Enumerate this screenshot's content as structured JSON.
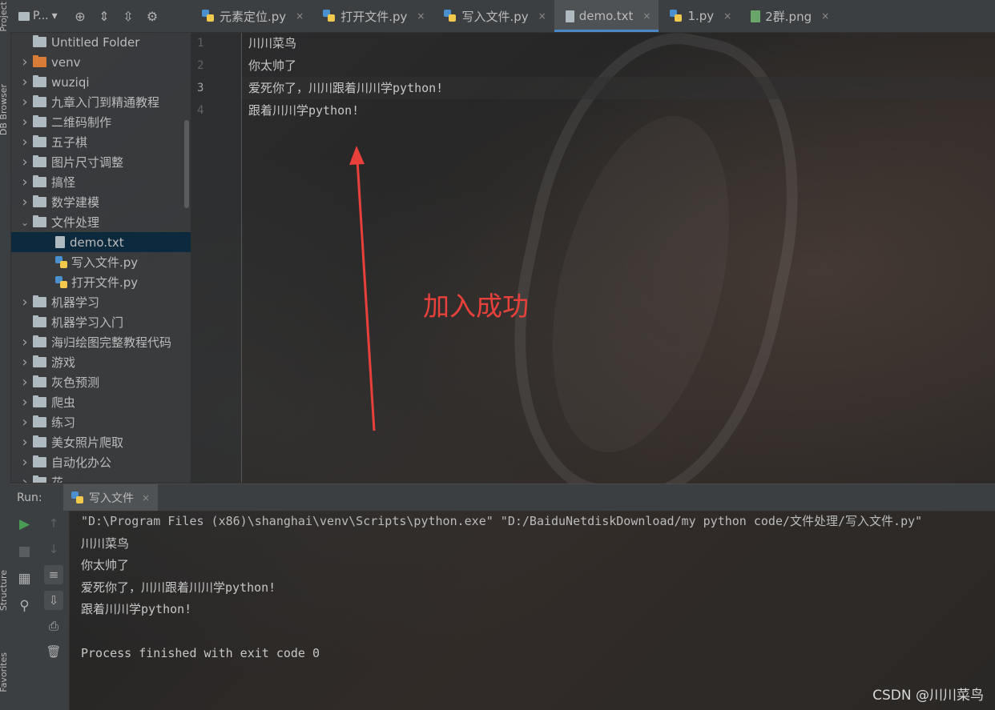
{
  "sidebar_strip": {
    "project_label": "Project",
    "db_label": "DB Browser",
    "structure_label": "Structure",
    "favorites_label": "Favorites"
  },
  "project_header": {
    "title": "P...",
    "dropdown_glyph": "▾"
  },
  "tree": [
    {
      "label": "Untitled Folder",
      "type": "folder",
      "expanded": null,
      "indent": 0
    },
    {
      "label": "venv",
      "type": "folder-orange",
      "expanded": false,
      "indent": 0
    },
    {
      "label": "wuziqi",
      "type": "folder",
      "expanded": false,
      "indent": 0
    },
    {
      "label": "九章入门到精通教程",
      "type": "folder",
      "expanded": false,
      "indent": 0
    },
    {
      "label": "二维码制作",
      "type": "folder",
      "expanded": false,
      "indent": 0
    },
    {
      "label": "五子棋",
      "type": "folder",
      "expanded": false,
      "indent": 0
    },
    {
      "label": "图片尺寸调整",
      "type": "folder",
      "expanded": false,
      "indent": 0
    },
    {
      "label": "搞怪",
      "type": "folder",
      "expanded": false,
      "indent": 0
    },
    {
      "label": "数学建模",
      "type": "folder",
      "expanded": false,
      "indent": 0
    },
    {
      "label": "文件处理",
      "type": "folder",
      "expanded": true,
      "indent": 0
    },
    {
      "label": "demo.txt",
      "type": "txt",
      "expanded": null,
      "indent": 1,
      "selected": true
    },
    {
      "label": "写入文件.py",
      "type": "py",
      "expanded": null,
      "indent": 1
    },
    {
      "label": "打开文件.py",
      "type": "py",
      "expanded": null,
      "indent": 1
    },
    {
      "label": "机器学习",
      "type": "folder",
      "expanded": false,
      "indent": 0
    },
    {
      "label": "机器学习入门",
      "type": "folder",
      "expanded": null,
      "indent": 0
    },
    {
      "label": "海归绘图完整教程代码",
      "type": "folder",
      "expanded": false,
      "indent": 0
    },
    {
      "label": "游戏",
      "type": "folder",
      "expanded": false,
      "indent": 0
    },
    {
      "label": "灰色预测",
      "type": "folder",
      "expanded": false,
      "indent": 0
    },
    {
      "label": "爬虫",
      "type": "folder",
      "expanded": false,
      "indent": 0
    },
    {
      "label": "练习",
      "type": "folder",
      "expanded": false,
      "indent": 0
    },
    {
      "label": "美女照片爬取",
      "type": "folder",
      "expanded": false,
      "indent": 0
    },
    {
      "label": "自动化办公",
      "type": "folder",
      "expanded": false,
      "indent": 0
    },
    {
      "label": "花",
      "type": "folder",
      "expanded": false,
      "indent": 0
    }
  ],
  "tabs": [
    {
      "label": "元素定位.py",
      "icon": "py",
      "active": false
    },
    {
      "label": "打开文件.py",
      "icon": "py",
      "active": false
    },
    {
      "label": "写入文件.py",
      "icon": "py",
      "active": false
    },
    {
      "label": "demo.txt",
      "icon": "txt",
      "active": true
    },
    {
      "label": "1.py",
      "icon": "py",
      "active": false
    },
    {
      "label": "2群.png",
      "icon": "png",
      "active": false
    }
  ],
  "tab_close_glyph": "×",
  "editor": {
    "lines": [
      "川川菜鸟",
      "你太帅了",
      "爱死你了，川川跟着川川学python!",
      "跟着川川学python!"
    ],
    "line_numbers": [
      "1",
      "2",
      "3",
      "4"
    ],
    "current_line": 3
  },
  "annotation": {
    "text": "加入成功",
    "color": "#e8403a"
  },
  "run": {
    "label": "Run:",
    "tab_label": "写入文件",
    "console": [
      "\"D:\\Program Files (x86)\\shanghai\\venv\\Scripts\\python.exe\" \"D:/BaiduNetdiskDownload/my python code/文件处理/写入文件.py\"",
      "川川菜鸟",
      "你太帅了",
      "爱死你了，川川跟着川川学python!",
      "跟着川川学python!",
      "",
      "Process finished with exit code 0"
    ]
  },
  "watermark": "CSDN @川川菜鸟",
  "colors": {
    "accent": "#4a88c7",
    "selection": "#0d293e",
    "panel": "#3c3f41",
    "run_green": "#499c54"
  }
}
